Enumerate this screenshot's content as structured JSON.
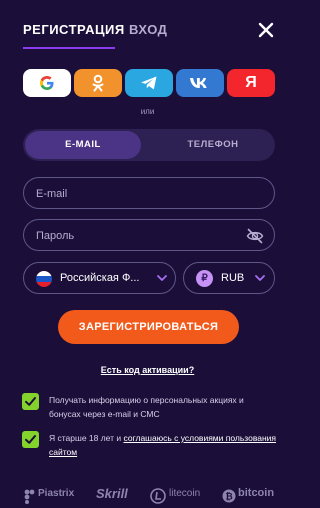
{
  "header": {
    "tab_register": "РЕГИСТРАЦИЯ",
    "tab_login": "ВХОД"
  },
  "social": {
    "google_icon": "google-icon",
    "ok_icon": "odnoklassniki-icon",
    "telegram_icon": "telegram-icon",
    "vk_icon": "vk-icon",
    "yandex_icon": "yandex-icon",
    "yandex_letter": "Я"
  },
  "or_label": "или",
  "segment": {
    "email_label": "E-MAIL",
    "phone_label": "ТЕЛЕФОН"
  },
  "form": {
    "email_placeholder": "E-mail",
    "password_placeholder": "Пароль",
    "country_value": "Российская Ф...",
    "currency_value": "RUB",
    "currency_symbol": "₽"
  },
  "cta_label": "ЗАРЕГИСТРИРОВАТЬСЯ",
  "activation_link": "Есть код активации?",
  "consents": {
    "promo_text": "Получать информацию о персональных акциях и бонусах через e-mail и СМС",
    "age_text_prefix": "Я старше 18 лет и ",
    "age_text_link": "соглашаюсь с условиями пользования сайтом"
  },
  "payments": {
    "piastrix": "Piastrix",
    "skrill": "Skrill",
    "litecoin": "litecoin",
    "bitcoin": "bitcoin"
  },
  "colors": {
    "background": "#1b0f3a",
    "accent": "#8a3cf0",
    "cta": "#f25a1c",
    "checkbox": "#84d32d"
  }
}
